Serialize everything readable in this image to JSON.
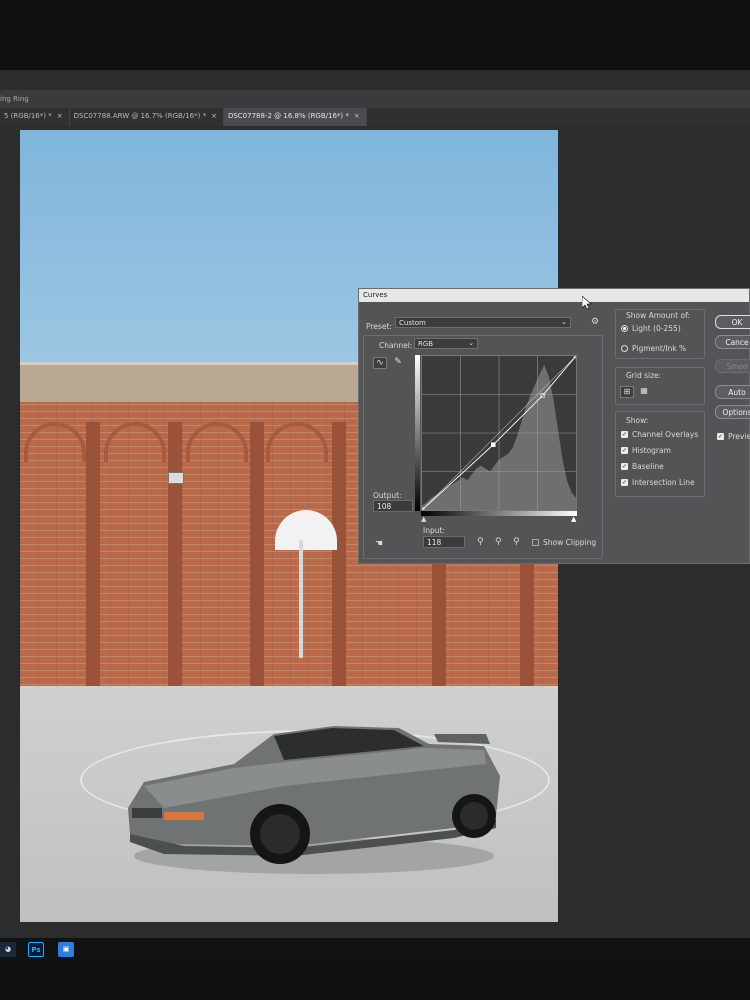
{
  "app": {
    "menu_text": "ing Ring"
  },
  "tabs": [
    {
      "label": "5 (RGB/16*) *",
      "active": false
    },
    {
      "label": "DSC07788.ARW @ 16.7% (RGB/16*) *",
      "active": false
    },
    {
      "label": "DSC07788-2 @ 16.8% (RGB/16*) *",
      "active": true
    }
  ],
  "curves": {
    "title": "Curves",
    "preset_label": "Preset:",
    "preset_value": "Custom",
    "channel_label": "Channel:",
    "channel_value": "RGB",
    "output_label": "Output:",
    "output_value": "108",
    "input_label": "Input:",
    "input_value": "118",
    "show_clipping_label": "Show Clipping",
    "show_clipping_checked": false,
    "show_amount_label": "Show Amount of:",
    "light_label": "Light  (0-255)",
    "pigment_label": "Pigment/Ink %",
    "amount_selected": "light",
    "grid_size_label": "Grid size:",
    "show_label": "Show:",
    "options": [
      {
        "label": "Channel Overlays",
        "checked": true
      },
      {
        "label": "Histogram",
        "checked": true
      },
      {
        "label": "Baseline",
        "checked": true
      },
      {
        "label": "Intersection Line",
        "checked": true
      }
    ],
    "buttons": {
      "ok": "OK",
      "cancel": "Cance",
      "smooth": "Smoo",
      "auto": "Auto",
      "options": "Options",
      "preview": "Previe"
    },
    "preview_checked": true,
    "curve_points": [
      [
        0,
        0
      ],
      [
        118,
        108
      ],
      [
        200,
        190
      ],
      [
        255,
        255
      ]
    ]
  },
  "taskbar": {
    "ps_label": "Ps"
  },
  "colors": {
    "accent_blue": "#2f7de1",
    "dialog_bg": "#535456"
  }
}
